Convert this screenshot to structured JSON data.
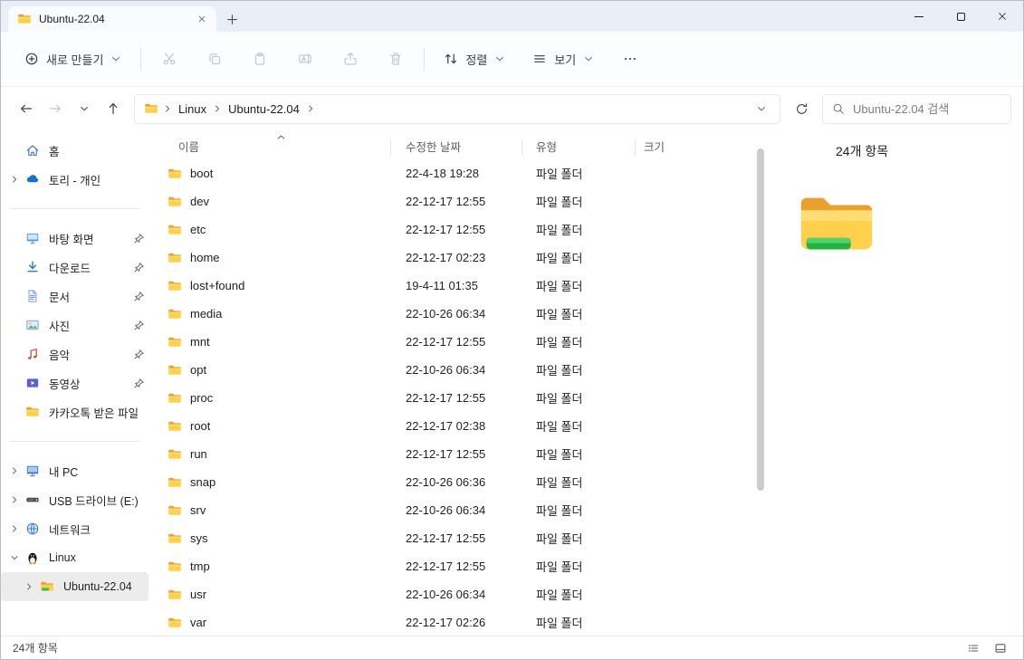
{
  "window": {
    "tab_title": "Ubuntu-22.04"
  },
  "toolbar": {
    "new_label": "새로 만들기",
    "sort_label": "정렬",
    "view_label": "보기"
  },
  "addressbar": {
    "breadcrumbs": [
      "Linux",
      "Ubuntu-22.04"
    ],
    "search_placeholder": "Ubuntu-22.04 검색"
  },
  "sidebar": {
    "items": [
      {
        "id": "home",
        "label": "홈",
        "icon": "home"
      },
      {
        "id": "onedrive",
        "label": "토리 - 개인",
        "icon": "onedrive",
        "expandable": true
      },
      {
        "type": "divider"
      },
      {
        "id": "desktop",
        "label": "바탕 화면",
        "icon": "desktop",
        "pinned": true
      },
      {
        "id": "downloads",
        "label": "다운로드",
        "icon": "downloads",
        "pinned": true
      },
      {
        "id": "documents",
        "label": "문서",
        "icon": "documents",
        "pinned": true
      },
      {
        "id": "pictures",
        "label": "사진",
        "icon": "pictures",
        "pinned": true
      },
      {
        "id": "music",
        "label": "음악",
        "icon": "music",
        "pinned": true
      },
      {
        "id": "videos",
        "label": "동영상",
        "icon": "videos",
        "pinned": true
      },
      {
        "id": "kakaotalk",
        "label": "카카오톡 받은 파일",
        "icon": "folder"
      },
      {
        "type": "divider"
      },
      {
        "id": "this-pc",
        "label": "내 PC",
        "icon": "pc",
        "expandable": true
      },
      {
        "id": "usb-drive",
        "label": "USB 드라이브 (E:)",
        "icon": "usb",
        "expandable": true
      },
      {
        "id": "network",
        "label": "네트워크",
        "icon": "network",
        "expandable": true
      },
      {
        "id": "linux",
        "label": "Linux",
        "icon": "linux",
        "expandable": true,
        "expanded": true
      },
      {
        "id": "ubuntu-22-04",
        "label": "Ubuntu-22.04",
        "icon": "ubuntu-folder",
        "expandable": true,
        "child": true,
        "selected": true
      }
    ]
  },
  "filelist": {
    "columns": [
      "이름",
      "수정한 날짜",
      "유형",
      "크기"
    ],
    "rows": [
      {
        "name": "boot",
        "modified": "22-4-18 19:28",
        "type": "파일 폴더",
        "size": ""
      },
      {
        "name": "dev",
        "modified": "22-12-17 12:55",
        "type": "파일 폴더",
        "size": ""
      },
      {
        "name": "etc",
        "modified": "22-12-17 12:55",
        "type": "파일 폴더",
        "size": ""
      },
      {
        "name": "home",
        "modified": "22-12-17 02:23",
        "type": "파일 폴더",
        "size": ""
      },
      {
        "name": "lost+found",
        "modified": "19-4-11 01:35",
        "type": "파일 폴더",
        "size": ""
      },
      {
        "name": "media",
        "modified": "22-10-26 06:34",
        "type": "파일 폴더",
        "size": ""
      },
      {
        "name": "mnt",
        "modified": "22-12-17 12:55",
        "type": "파일 폴더",
        "size": ""
      },
      {
        "name": "opt",
        "modified": "22-10-26 06:34",
        "type": "파일 폴더",
        "size": ""
      },
      {
        "name": "proc",
        "modified": "22-12-17 12:55",
        "type": "파일 폴더",
        "size": ""
      },
      {
        "name": "root",
        "modified": "22-12-17 02:38",
        "type": "파일 폴더",
        "size": ""
      },
      {
        "name": "run",
        "modified": "22-12-17 12:55",
        "type": "파일 폴더",
        "size": ""
      },
      {
        "name": "snap",
        "modified": "22-10-26 06:36",
        "type": "파일 폴더",
        "size": ""
      },
      {
        "name": "srv",
        "modified": "22-10-26 06:34",
        "type": "파일 폴더",
        "size": ""
      },
      {
        "name": "sys",
        "modified": "22-12-17 12:55",
        "type": "파일 폴더",
        "size": ""
      },
      {
        "name": "tmp",
        "modified": "22-12-17 12:55",
        "type": "파일 폴더",
        "size": ""
      },
      {
        "name": "usr",
        "modified": "22-10-26 06:34",
        "type": "파일 폴더",
        "size": ""
      },
      {
        "name": "var",
        "modified": "22-12-17 02:26",
        "type": "파일 폴더",
        "size": ""
      }
    ]
  },
  "preview": {
    "items_count": "24개 항목"
  },
  "statusbar": {
    "items_count": "24개 항목"
  }
}
